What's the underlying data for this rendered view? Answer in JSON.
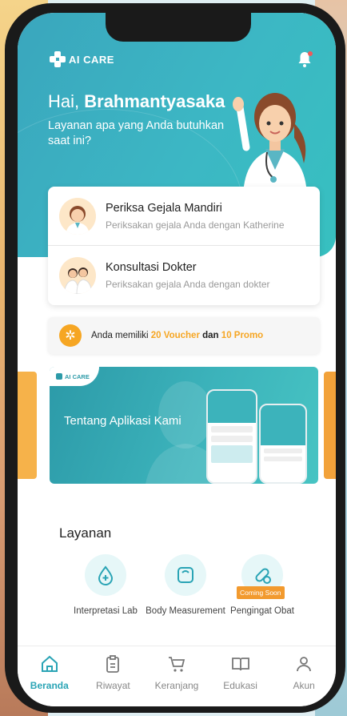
{
  "app": {
    "name": "AI CARE"
  },
  "header": {
    "greeting_prefix": "Hai,",
    "user_name": "Brahmantyasaka",
    "subtitle": "Layanan apa yang Anda butuhkan saat ini?"
  },
  "features": [
    {
      "title": "Periksa Gejala Mandiri",
      "desc": "Periksakan gejala Anda dengan Katherine"
    },
    {
      "title": "Konsultasi Dokter",
      "desc": "Periksakan gejala Anda dengan dokter"
    }
  ],
  "voucher": {
    "prefix": "Anda memiliki",
    "vouchers": "20 Voucher",
    "mid": "dan",
    "promos": "10 Promo"
  },
  "banner": {
    "title": "Tentang Aplikasi Kami",
    "brand": "AI CARE"
  },
  "services": {
    "title": "Layanan",
    "items": [
      {
        "label": "Interpretasi Lab",
        "icon": "lab-drop-icon"
      },
      {
        "label": "Body Measurement",
        "icon": "scale-icon"
      },
      {
        "label": "Pengingat Obat",
        "icon": "pill-icon",
        "badge": "Coming Soon"
      }
    ]
  },
  "nav": [
    {
      "label": "Beranda",
      "icon": "home-icon",
      "active": true
    },
    {
      "label": "Riwayat",
      "icon": "clipboard-icon"
    },
    {
      "label": "Keranjang",
      "icon": "cart-icon"
    },
    {
      "label": "Edukasi",
      "icon": "book-icon"
    },
    {
      "label": "Akun",
      "icon": "user-icon"
    }
  ],
  "colors": {
    "primary": "#3aa6bd",
    "accent": "#f6a623",
    "active_nav": "#2aa4b5"
  }
}
